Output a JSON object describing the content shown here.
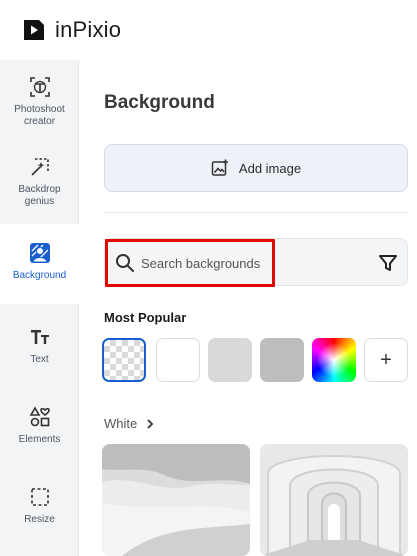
{
  "app": {
    "name": "inPixio"
  },
  "sidebar": {
    "items": [
      {
        "label": "Photoshoot creator",
        "icon": "photoshoot-icon"
      },
      {
        "label": "Backdrop genius",
        "icon": "backdrop-genius-icon"
      },
      {
        "label": "Background",
        "icon": "background-icon",
        "active": true
      },
      {
        "label": "Text",
        "icon": "text-icon"
      },
      {
        "label": "Elements",
        "icon": "elements-icon"
      },
      {
        "label": "Resize",
        "icon": "resize-icon"
      }
    ]
  },
  "panel": {
    "title": "Background",
    "add_image_label": "Add image",
    "search": {
      "placeholder": "Search backgrounds",
      "value": ""
    },
    "most_popular_label": "Most Popular",
    "swatches": [
      {
        "name": "transparent",
        "selected": true
      },
      {
        "name": "white",
        "color": "#ffffff"
      },
      {
        "name": "light-gray",
        "color": "#d9d9d9"
      },
      {
        "name": "gray",
        "color": "#bdbdbd"
      },
      {
        "name": "color-picker"
      },
      {
        "name": "add-color",
        "symbol": "+"
      }
    ],
    "category": {
      "label": "White"
    },
    "thumbnails": [
      {
        "name": "white-desert-dunes"
      },
      {
        "name": "white-arched-hallway"
      }
    ]
  },
  "colors": {
    "accent": "#1a5fd0",
    "highlight": "#e10600",
    "sidebar_bg": "#f3f4f6"
  }
}
